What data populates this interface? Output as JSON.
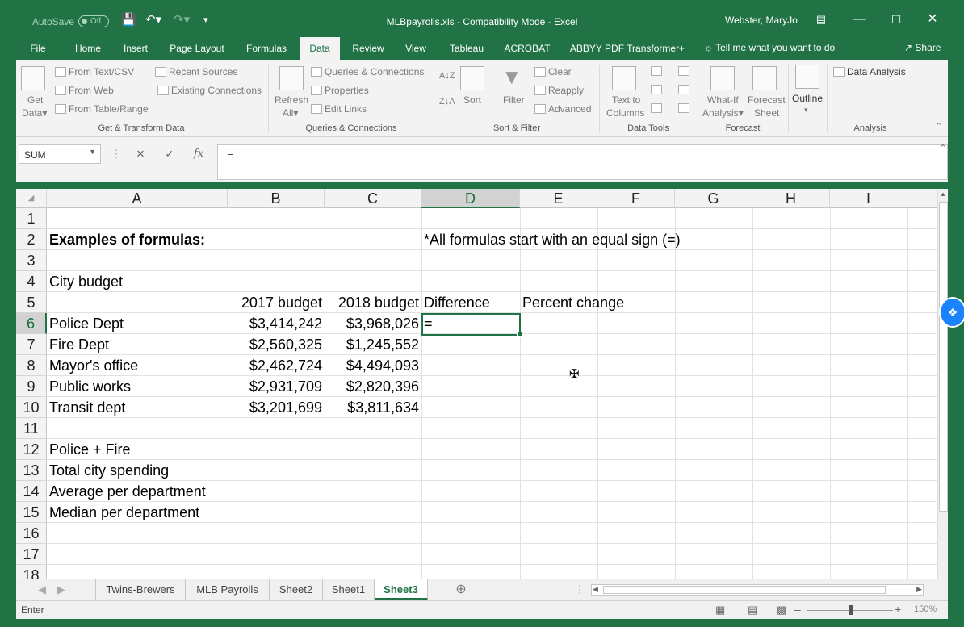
{
  "titlebar": {
    "autosave": "AutoSave",
    "autosave_state": "Off",
    "doc_title": "MLBpayrolls.xls  -  Compatibility Mode  -  Excel",
    "user": "Webster, MaryJo"
  },
  "tabs": [
    "File",
    "Home",
    "Insert",
    "Page Layout",
    "Formulas",
    "Data",
    "Review",
    "View",
    "Tableau",
    "ACROBAT",
    "ABBYY PDF Transformer+"
  ],
  "active_tab": "Data",
  "tell_me": "Tell me what you want to do",
  "share": "Share",
  "ribbon": {
    "get_data": "Get",
    "get_data2": "Data",
    "from_text": "From Text/CSV",
    "from_web": "From Web",
    "from_table": "From Table/Range",
    "recent_sources": "Recent Sources",
    "existing_connections": "Existing Connections",
    "group_get_transform": "Get & Transform Data",
    "refresh": "Refresh",
    "refresh_all": "All",
    "queries_connections": "Queries & Connections",
    "properties": "Properties",
    "edit_links": "Edit Links",
    "group_queries": "Queries & Connections",
    "sort": "Sort",
    "filter": "Filter",
    "clear": "Clear",
    "reapply": "Reapply",
    "advanced": "Advanced",
    "group_sort_filter": "Sort & Filter",
    "text_to_columns": "Text to",
    "text_to_columns2": "Columns",
    "group_data_tools": "Data Tools",
    "what_if": "What-If",
    "what_if2": "Analysis",
    "forecast_sheet": "Forecast",
    "forecast_sheet2": "Sheet",
    "group_forecast": "Forecast",
    "outline": "Outline",
    "data_analysis": "Data Analysis",
    "group_analysis": "Analysis"
  },
  "formula_bar": {
    "name_box": "SUM",
    "formula": "="
  },
  "columns": [
    "A",
    "B",
    "C",
    "D",
    "E",
    "F",
    "G",
    "H",
    "I"
  ],
  "rows": [
    "1",
    "2",
    "3",
    "4",
    "5",
    "6",
    "7",
    "8",
    "9",
    "10",
    "11",
    "12",
    "13",
    "14",
    "15",
    "16",
    "17",
    "18"
  ],
  "cells": {
    "A2": "Examples of formulas:",
    "D2": "*All formulas start with an equal sign (=)",
    "A4": "City budget",
    "B5": "2017 budget",
    "C5": "2018 budget",
    "D5": "Difference",
    "E5": "Percent change",
    "A6": "Police Dept",
    "B6": "$3,414,242",
    "C6": "$3,968,026",
    "D6": "=",
    "A7": "Fire Dept",
    "B7": "$2,560,325",
    "C7": "$1,245,552",
    "A8": "Mayor's office",
    "B8": "$2,462,724",
    "C8": "$4,494,093",
    "A9": "Public works",
    "B9": "$2,931,709",
    "C9": "$2,820,396",
    "A10": "Transit dept",
    "B10": "$3,201,699",
    "C10": "$3,811,634",
    "A12": "Police + Fire",
    "A13": "Total city spending",
    "A14": "Average per department",
    "A15": "Median per department"
  },
  "sheets": [
    "Twins-Brewers",
    "MLB Payrolls",
    "Sheet2",
    "Sheet1",
    "Sheet3"
  ],
  "active_sheet": "Sheet3",
  "status": {
    "mode": "Enter",
    "zoom": "150%"
  }
}
